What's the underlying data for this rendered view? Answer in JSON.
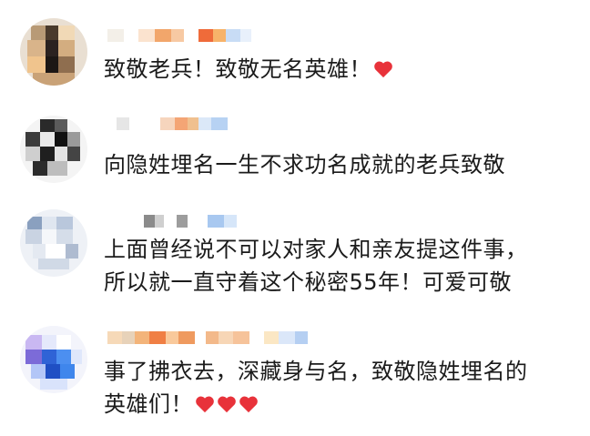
{
  "comments": [
    {
      "lines": [
        "致敬老兵！致敬无名英雄！"
      ],
      "hearts": 1,
      "avatar_icon": "pixelated-avatar-icon"
    },
    {
      "lines": [
        "向隐姓埋名一生不求功名成就的老兵致敬"
      ],
      "hearts": 0,
      "avatar_icon": "pixelated-avatar-icon"
    },
    {
      "lines": [
        "上面曾经说不可以对家人和亲友提这件事，",
        "所以就一直守着这个秘密55年！可爱可敬"
      ],
      "hearts": 0,
      "avatar_icon": "pixelated-avatar-icon"
    },
    {
      "lines": [
        "事了拂衣去，深藏身与名，致敬隐姓埋名的",
        "英雄们！"
      ],
      "hearts": 3,
      "avatar_icon": "pixelated-avatar-icon"
    }
  ],
  "colors": {
    "text": "#1b1b1b",
    "heart": "#e8323a",
    "background": "#ffffff"
  }
}
